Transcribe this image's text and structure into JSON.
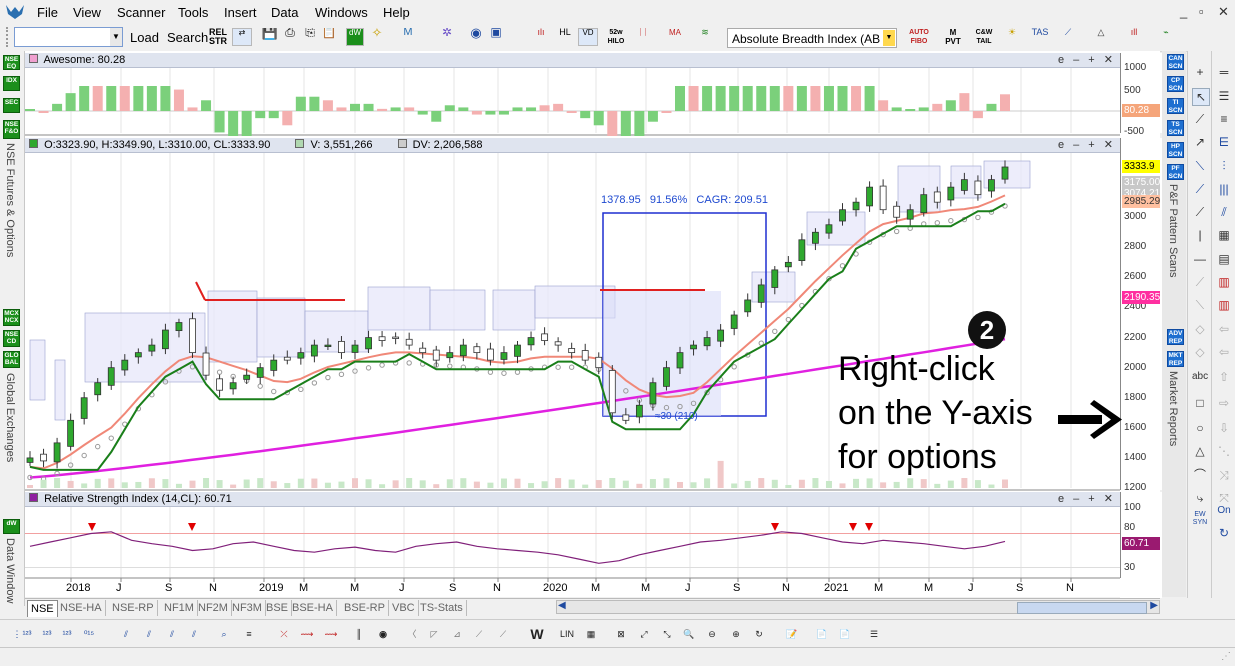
{
  "menu": {
    "items": [
      "File",
      "View",
      "Scanner",
      "Tools",
      "Insert",
      "Data",
      "Windows",
      "Help"
    ]
  },
  "window_controls": {
    "minimize": "_",
    "restore": "▫",
    "close": "✕"
  },
  "toolbar": {
    "symbol_value": "",
    "load_label": "Load",
    "search_label": "Search",
    "rel_str": "REL STR",
    "w52_label": "52w HILO",
    "indicator_select": "Absolute Breadth Index (AB",
    "auto_fibo": "AUTO FIBO",
    "mpvt": "M PVT",
    "cew_tail": "C&W TAIL"
  },
  "left_strip": {
    "buttons": [
      "NSE EQ",
      "IDX",
      "SEC",
      "NSE F&O",
      "MCX NCX",
      "NSE CD",
      "GLO BAL",
      "dW"
    ],
    "labels": [
      "NSE Futures & Options",
      "Global Exchanges",
      "Data Window"
    ]
  },
  "awesome_panel": {
    "title": "Awesome: 80.28",
    "y_ticks": [
      "1000",
      "500",
      "0",
      "-500"
    ],
    "value_tag": "80.28",
    "controls": "e – + ✕"
  },
  "price_panel": {
    "ohlc": "O:3323.90, H:3349.90, L:3310.00, CL:3333.90",
    "volume": "V: 3,551,266",
    "dv": "DV: 2,206,588",
    "controls": "e – + ✕",
    "y_ticks": [
      "3200",
      "3000",
      "2800",
      "2600",
      "2400",
      "2200",
      "2000",
      "1800",
      "1600",
      "1400",
      "1200"
    ],
    "tags": [
      {
        "text": "3333.9",
        "color": "#ffff00"
      },
      {
        "text": "3175.00",
        "color": "#c8c8c8"
      },
      {
        "text": "3074.21",
        "color": "#c8c8c8"
      },
      {
        "text": "2985.29",
        "color": "#ffc0a0"
      },
      {
        "text": "2190.35",
        "color": "#ff2fa0"
      }
    ],
    "measure_box": {
      "label": "1378.95   91.56%   CAGR: 209.51",
      "sub": "≈30 (210)"
    }
  },
  "rsi_panel": {
    "title": "Relative Strength Index (14,CL): 60.71",
    "y_ticks": [
      "100",
      "80",
      "60",
      "30"
    ],
    "value_tag": "60.71",
    "controls": "e – + ✕"
  },
  "x_axis": {
    "labels": [
      "2018",
      "J",
      "S",
      "N",
      "2019",
      "M",
      "M",
      "J",
      "S",
      "N",
      "2020",
      "M",
      "M",
      "J",
      "S",
      "N",
      "2021",
      "M",
      "M",
      "J",
      "S",
      "N"
    ]
  },
  "annotation": {
    "number": "2",
    "line1": "Right-click",
    "line2": "on the Y-axis",
    "line3": "for options"
  },
  "right_panel": {
    "buttons": [
      "CAN SCN",
      "CP SCN",
      "TI SCN",
      "TS SCN",
      "HP SCN",
      "PF SCN",
      "ADV REP",
      "MKT REP"
    ],
    "labels": [
      "P&F Pattern Scans",
      "Market Reports"
    ]
  },
  "tabs": [
    "NSE",
    "NSE-HA",
    "NSE-RP",
    "NF1M",
    "NF2M",
    "NF3M",
    "BSE",
    "BSE-HA",
    "BSE-RP",
    "VBC",
    "TS-Stats"
  ],
  "active_tab": "NSE",
  "drawing_tools": {
    "text_tool": "abc",
    "on_label": "On",
    "ew_label": "EW SYN"
  },
  "bottom_toolbar": {
    "lin_label": "LIN",
    "w_label": "W"
  },
  "chart_data": [
    {
      "type": "candlestick",
      "title": "",
      "x_labels": [
        "2018",
        "J",
        "S",
        "N",
        "2019",
        "M",
        "M",
        "J",
        "S",
        "N",
        "2020",
        "M",
        "M",
        "J",
        "S",
        "N",
        "2021",
        "M",
        "M",
        "J",
        "S",
        "N"
      ],
      "y_range": [
        1200,
        3350
      ],
      "close_points": [
        1400,
        1380,
        1500,
        1650,
        1800,
        1900,
        2000,
        2050,
        2100,
        2150,
        2250,
        2300,
        2100,
        1950,
        1850,
        1900,
        1950,
        2000,
        2050,
        2050,
        2100,
        2150,
        2150,
        2100,
        2150,
        2200,
        2180,
        2200,
        2150,
        2100,
        2050,
        2100,
        2150,
        2100,
        2050,
        2100,
        2150,
        2200,
        2180,
        2150,
        2100,
        2050,
        2000,
        1700,
        1650,
        1750,
        1900,
        2000,
        2100,
        2150,
        2200,
        2250,
        2350,
        2450,
        2550,
        2650,
        2700,
        2850,
        2900,
        2950,
        3050,
        3100,
        3200,
        3050,
        3000,
        3050,
        3150,
        3100,
        3200,
        3250,
        3150,
        3250,
        3333.9
      ],
      "series": [
        {
          "name": "50 period MA",
          "color": "#f08080"
        },
        {
          "name": "200 period MA",
          "color": "#e020e0"
        },
        {
          "name": "Supertrend",
          "color": "#208020"
        },
        {
          "name": "SAR",
          "color": "#999999"
        }
      ]
    },
    {
      "type": "line",
      "title": "Relative Strength Index (14,CL): 60.71",
      "y_range": [
        0,
        100
      ],
      "values": [
        55,
        60,
        65,
        70,
        72,
        62,
        58,
        55,
        50,
        52,
        58,
        60,
        55,
        50,
        48,
        52,
        54,
        50,
        48,
        55,
        58,
        60,
        55,
        52,
        50,
        48,
        45,
        40,
        35,
        38,
        45,
        50,
        55,
        60,
        62,
        65,
        68,
        72,
        70,
        65,
        60,
        58,
        62,
        60,
        58,
        55,
        52,
        55,
        60.71
      ]
    }
  ]
}
